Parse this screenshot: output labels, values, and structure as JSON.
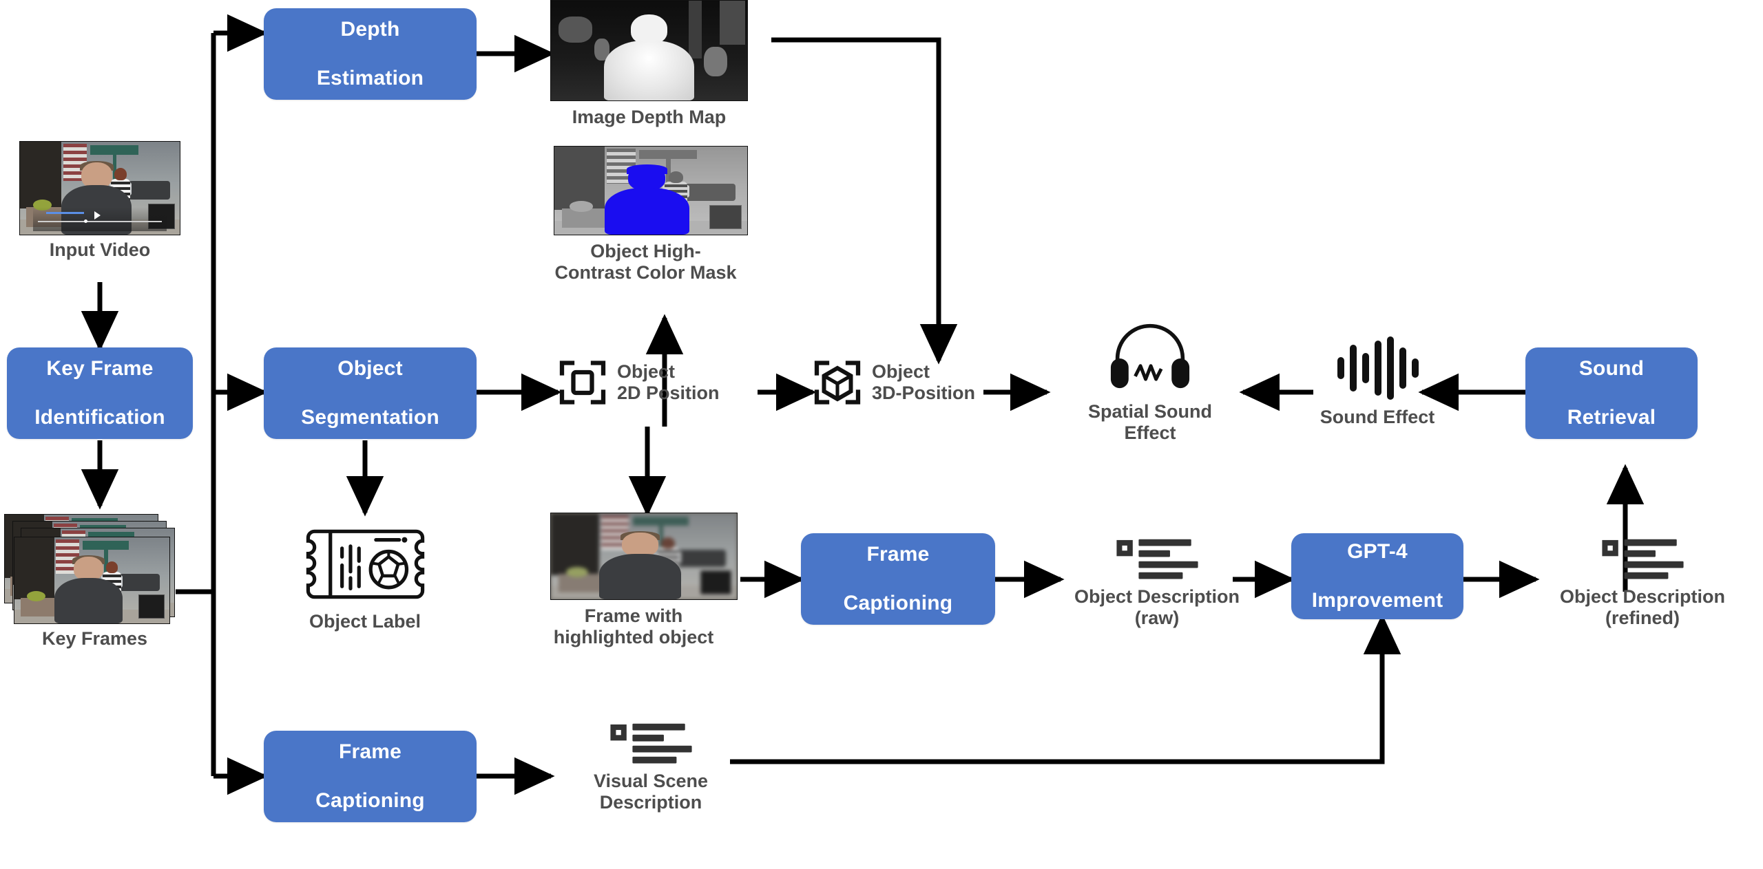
{
  "diagram": {
    "title": "Spatial sound effect generation pipeline",
    "accent_color": "#4A76C8",
    "text_color": "#4d4d4d",
    "line_color": "#000000"
  },
  "process_boxes": {
    "key_frame_identification": "Key Frame\nIdentification",
    "key_frame_identification_l1": "Key Frame",
    "key_frame_identification_l2": "Identification",
    "depth_estimation_l1": "Depth",
    "depth_estimation_l2": "Estimation",
    "object_segmentation_l1": "Object",
    "object_segmentation_l2": "Segmentation",
    "frame_captioning_mid_l1": "Frame",
    "frame_captioning_mid_l2": "Captioning",
    "frame_captioning_bottom_l1": "Frame",
    "frame_captioning_bottom_l2": "Captioning",
    "gpt4_improvement_l1": "GPT-4",
    "gpt4_improvement_l2": "Improvement",
    "sound_retrieval_l1": "Sound",
    "sound_retrieval_l2": "Retrieval"
  },
  "artifacts": {
    "input_video": "Input Video",
    "key_frames": "Key Frames",
    "image_depth_map": "Image Depth Map",
    "object_high_contrast_color_mask_l1": "Object High-",
    "object_high_contrast_color_mask_l2": "Contrast Color Mask",
    "object_label": "Object Label",
    "object_2d_position_l1": "Object",
    "object_2d_position_l2": "2D Position",
    "object_3d_position_l1": "Object",
    "object_3d_position_l2": "3D-Position",
    "spatial_sound_effect_l1": "Spatial Sound",
    "spatial_sound_effect_l2": "Effect",
    "sound_effect": "Sound Effect",
    "frame_with_highlighted_object_l1": "Frame with",
    "frame_with_highlighted_object_l2": "highlighted object",
    "object_description_raw_l1": "Object Description",
    "object_description_raw_l2": "(raw)",
    "object_description_refined_l1": "Object Description",
    "object_description_refined_l2": "(refined)",
    "visual_scene_description_l1": "Visual Scene",
    "visual_scene_description_l2": "Description"
  },
  "icons": {
    "crop_2d": "2d-position-icon",
    "cube_3d": "3d-position-icon",
    "headphones": "headphones-icon",
    "waveform": "sound-waveform-icon",
    "ticket": "object-label-ticket-icon",
    "document": "document-lines-icon"
  }
}
